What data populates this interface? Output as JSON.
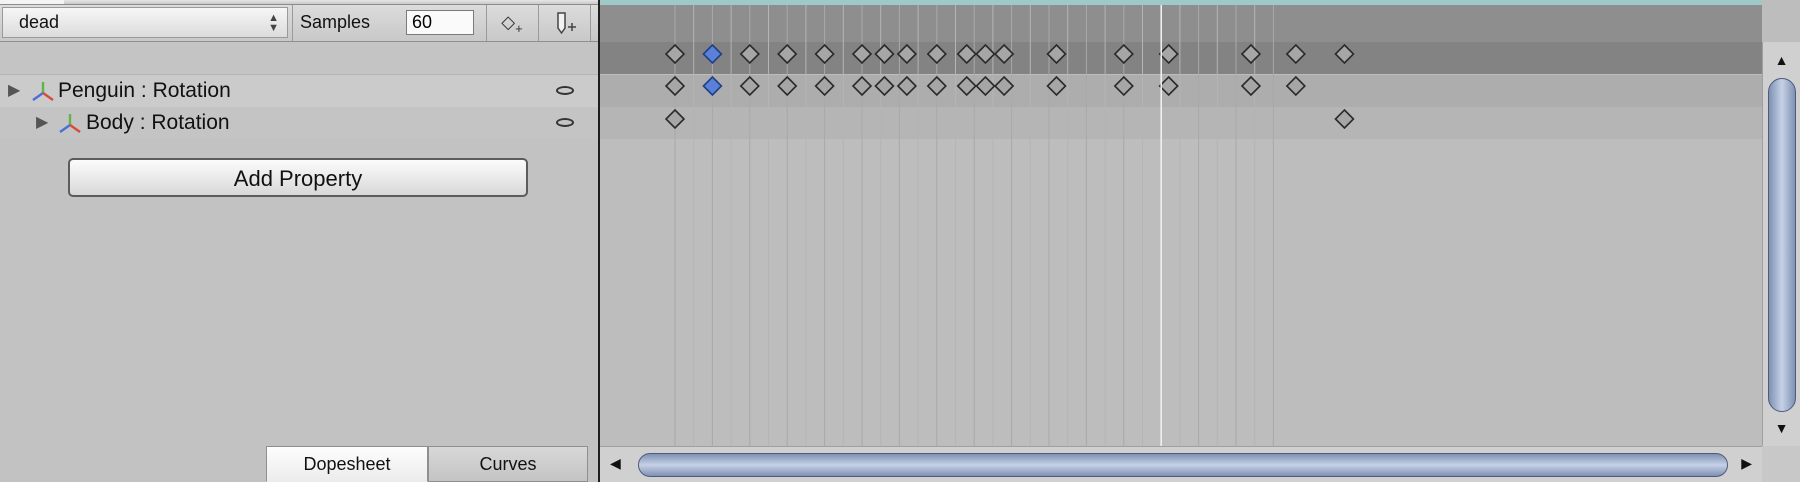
{
  "toolbar": {
    "clip_name": "dead",
    "samples_label": "Samples",
    "samples_value": "60",
    "add_keyframe_icon": "add-keyframe-icon",
    "add_event_icon": "add-event-icon"
  },
  "properties": [
    {
      "label": "Penguin : Rotation",
      "icon": "rotation-axis-icon",
      "visibility_icon": "eye-icon"
    },
    {
      "label": "Body : Rotation",
      "icon": "rotation-axis-icon",
      "visibility_icon": "eye-icon"
    }
  ],
  "add_property_label": "Add Property",
  "tabs": [
    {
      "label": "Dopesheet",
      "active": true
    },
    {
      "label": "Curves",
      "active": false
    }
  ],
  "timeline": {
    "playhead_frame": 15,
    "keyframes": {
      "summary": [
        2,
        3,
        4,
        5,
        6,
        7,
        7.6,
        8.2,
        9,
        9.8,
        10.3,
        10.8,
        12.2,
        14,
        15.2,
        17.4,
        18.6,
        19.9
      ],
      "penguin_rotation": [
        2,
        3,
        4,
        5,
        6,
        7,
        7.6,
        8.2,
        9,
        9.8,
        10.3,
        10.8,
        12.2,
        14,
        15.2,
        17.4,
        18.6
      ],
      "body_rotation": [
        2,
        19.9
      ]
    },
    "selected_keyframe": 3
  },
  "colors": {
    "selected_key": "#5a80d8",
    "key": "#a6a6a6",
    "scroll_thumb": "#9aa9c8"
  }
}
